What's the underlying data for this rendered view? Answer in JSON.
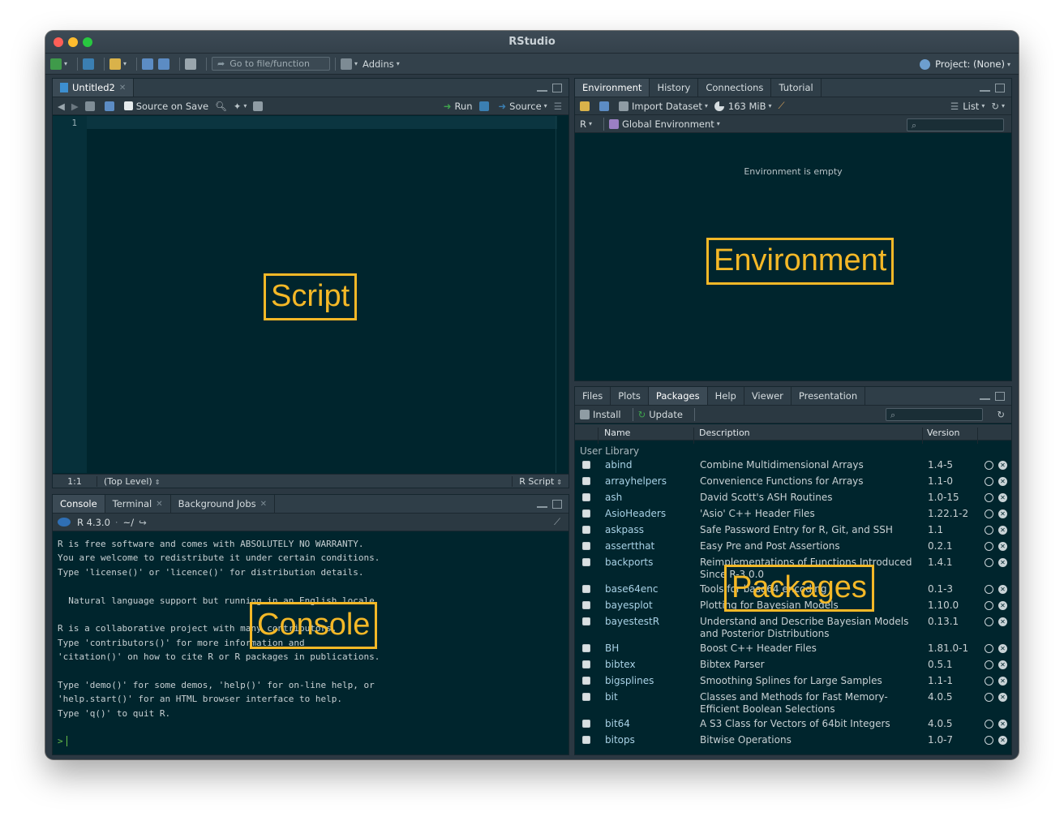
{
  "window": {
    "title": "RStudio"
  },
  "toolbar": {
    "goto_placeholder": "Go to file/function",
    "addins_label": "Addins",
    "project_label": "Project: (None)"
  },
  "source_pane": {
    "tab_label": "Untitled2",
    "source_on_save_label": "Source on Save",
    "run_label": "Run",
    "source_label": "Source",
    "line_number": "1",
    "cursor_position": "1:1",
    "scope": "(Top Level)",
    "file_type": "R Script"
  },
  "console_pane": {
    "tabs": [
      "Console",
      "Terminal",
      "Background Jobs"
    ],
    "r_version": "R 4.3.0",
    "working_dir": "~/",
    "text": "R is free software and comes with ABSOLUTELY NO WARRANTY.\nYou are welcome to redistribute it under certain conditions.\nType 'license()' or 'licence()' for distribution details.\n\n  Natural language support but running in an English locale\n\nR is a collaborative project with many contributors.\nType 'contributors()' for more information and\n'citation()' on how to cite R or R packages in publications.\n\nType 'demo()' for some demos, 'help()' for on-line help, or\n'help.start()' for an HTML browser interface to help.\nType 'q()' to quit R.",
    "prompt": ">"
  },
  "env_pane": {
    "tabs": [
      "Environment",
      "History",
      "Connections",
      "Tutorial"
    ],
    "import_dataset_label": "Import Dataset",
    "memory_label": "163 MiB",
    "list_label": "List",
    "language_label": "R",
    "global_env_label": "Global Environment",
    "empty_message": "Environment is empty"
  },
  "files_pane": {
    "tabs": [
      "Files",
      "Plots",
      "Packages",
      "Help",
      "Viewer",
      "Presentation"
    ],
    "install_label": "Install",
    "update_label": "Update",
    "columns": {
      "name": "Name",
      "description": "Description",
      "version": "Version"
    },
    "user_library_label": "User Library",
    "packages": [
      {
        "name": "abind",
        "description": "Combine Multidimensional Arrays",
        "version": "1.4-5"
      },
      {
        "name": "arrayhelpers",
        "description": "Convenience Functions for Arrays",
        "version": "1.1-0"
      },
      {
        "name": "ash",
        "description": "David Scott's ASH Routines",
        "version": "1.0-15"
      },
      {
        "name": "AsioHeaders",
        "description": "'Asio' C++ Header Files",
        "version": "1.22.1-2"
      },
      {
        "name": "askpass",
        "description": "Safe Password Entry for R, Git, and SSH",
        "version": "1.1"
      },
      {
        "name": "assertthat",
        "description": "Easy Pre and Post Assertions",
        "version": "0.2.1"
      },
      {
        "name": "backports",
        "description": "Reimplementations of Functions Introduced Since R-3.0.0",
        "version": "1.4.1"
      },
      {
        "name": "base64enc",
        "description": "Tools for base64 encoding",
        "version": "0.1-3"
      },
      {
        "name": "bayesplot",
        "description": "Plotting for Bayesian Models",
        "version": "1.10.0"
      },
      {
        "name": "bayestestR",
        "description": "Understand and Describe Bayesian Models and Posterior Distributions",
        "version": "0.13.1"
      },
      {
        "name": "BH",
        "description": "Boost C++ Header Files",
        "version": "1.81.0-1"
      },
      {
        "name": "bibtex",
        "description": "Bibtex Parser",
        "version": "0.5.1"
      },
      {
        "name": "bigsplines",
        "description": "Smoothing Splines for Large Samples",
        "version": "1.1-1"
      },
      {
        "name": "bit",
        "description": "Classes and Methods for Fast Memory-Efficient Boolean Selections",
        "version": "4.0.5"
      },
      {
        "name": "bit64",
        "description": "A S3 Class for Vectors of 64bit Integers",
        "version": "4.0.5"
      },
      {
        "name": "bitops",
        "description": "Bitwise Operations",
        "version": "1.0-7"
      }
    ]
  },
  "overlays": {
    "script": "Script",
    "environment": "Environment",
    "console": "Console",
    "packages": "Packages"
  },
  "colors": {
    "accent": "#f4b827",
    "editor_bg": "#00252d",
    "chrome_bg": "#2b3842"
  }
}
